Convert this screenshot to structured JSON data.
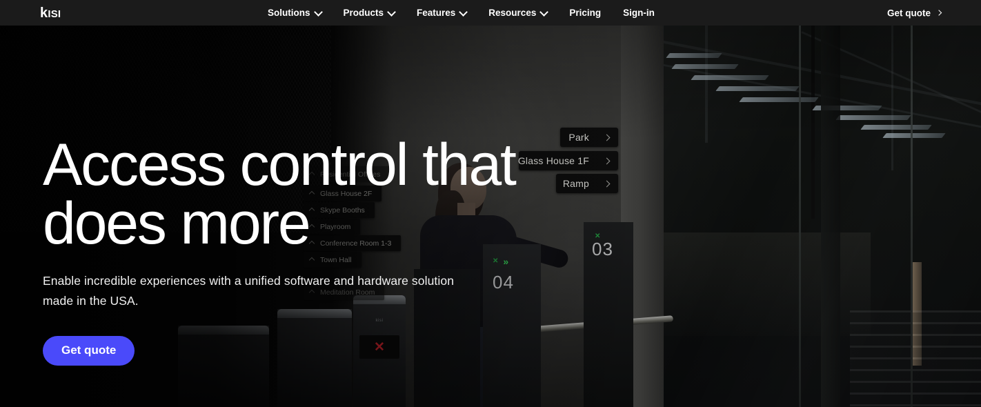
{
  "nav": {
    "logo": "kisi",
    "items": [
      {
        "label": "Solutions",
        "icon": "chevron-down-icon",
        "has_caret": true
      },
      {
        "label": "Products",
        "icon": "chevron-down-icon",
        "has_caret": true
      },
      {
        "label": "Features",
        "icon": "chevron-down-icon",
        "has_caret": true
      },
      {
        "label": "Resources",
        "icon": "chevron-down-icon",
        "has_caret": true
      },
      {
        "label": "Pricing",
        "icon": "",
        "has_caret": false
      },
      {
        "label": "Sign-in",
        "icon": "",
        "has_caret": false
      }
    ],
    "cta": {
      "label": "Get quote",
      "icon": "chevron-right-icon"
    },
    "background": "#1b1b1b"
  },
  "hero": {
    "headline_line1": "Access control that",
    "headline_line2": "does more",
    "subhead": "Enable incredible experiences with a unified software and hardware solution made in the USA.",
    "cta_label": "Get quote",
    "cta_color": "#4a4afa"
  },
  "scene": {
    "signs_right": [
      {
        "label": "Park",
        "icon": "chevron-right-icon"
      },
      {
        "label": "Glass House 1F",
        "icon": "chevron-right-icon"
      },
      {
        "label": "Ramp",
        "icon": "chevron-right-icon"
      }
    ],
    "signs_left": [
      {
        "label": "Residential Offices",
        "icon": "chevron-up-icon"
      },
      {
        "label": "Glass House 2F",
        "icon": "chevron-up-icon"
      },
      {
        "label": "Skype Booths",
        "icon": "chevron-up-icon"
      },
      {
        "label": "Playroom",
        "icon": "chevron-up-icon"
      },
      {
        "label": "Conference Room 1-3",
        "icon": "chevron-up-icon"
      },
      {
        "label": "Town Hall",
        "icon": "chevron-up-icon"
      },
      {
        "label": "Meditation Room",
        "icon": "chevron-up-icon"
      }
    ],
    "turnstiles": [
      {
        "number": "04",
        "deny_icon": "x-icon",
        "allow_icon": "double-chevron-icon",
        "brand": "kisi"
      },
      {
        "number": "03",
        "deny_icon": "x-icon",
        "allow_icon": "",
        "brand": ""
      }
    ],
    "turnstile_deny_glyph": "✕",
    "turnstile_allow_glyph": "»",
    "deny_color": "#c8232b",
    "allow_color": "#2fb24c"
  }
}
